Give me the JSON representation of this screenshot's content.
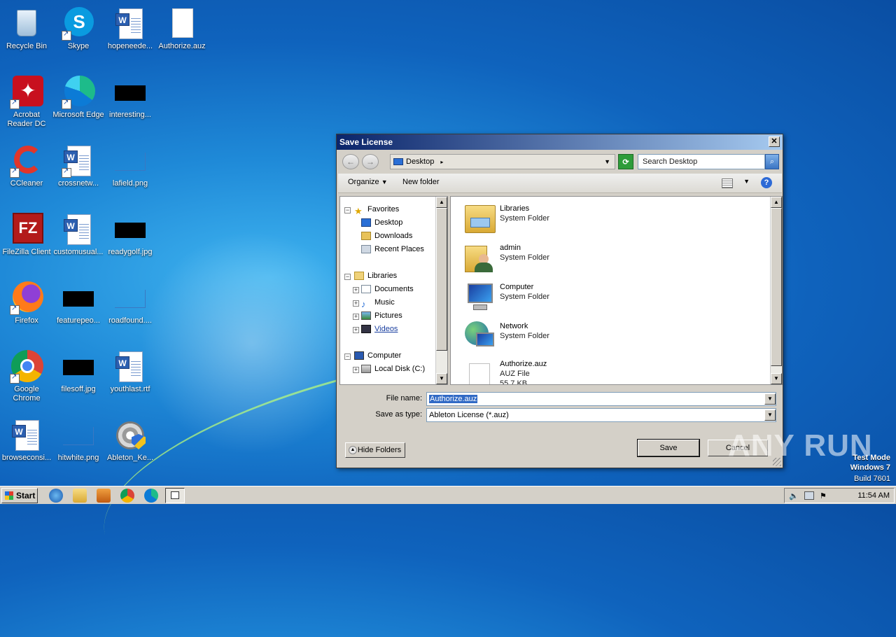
{
  "desktop": {
    "icons": [
      {
        "label": "Recycle Bin"
      },
      {
        "label": "Skype"
      },
      {
        "label": "hopeneede..."
      },
      {
        "label": "Authorize.auz"
      },
      {
        "label": "Acrobat Reader DC"
      },
      {
        "label": "Microsoft Edge"
      },
      {
        "label": "interesting..."
      },
      {
        "label": "CCleaner"
      },
      {
        "label": "crossnetw..."
      },
      {
        "label": "lafield.png"
      },
      {
        "label": "FileZilla Client"
      },
      {
        "label": "customusual..."
      },
      {
        "label": "readygolf.jpg"
      },
      {
        "label": "Firefox"
      },
      {
        "label": "featurepeo..."
      },
      {
        "label": "roadfound...."
      },
      {
        "label": "Google Chrome"
      },
      {
        "label": "filesoff.jpg"
      },
      {
        "label": "youthlast.rtf"
      },
      {
        "label": "browseconsi..."
      },
      {
        "label": "hitwhite.png"
      },
      {
        "label": "Ableton_Ke..."
      }
    ]
  },
  "dialog": {
    "title": "Save License",
    "close_glyph": "✕",
    "address": "Desktop",
    "search_placeholder": "Search Desktop",
    "toolbar": {
      "organize": "Organize",
      "new_folder": "New folder",
      "help": "?"
    },
    "nav": {
      "favorites": "Favorites",
      "desktop": "Desktop",
      "downloads": "Downloads",
      "recent": "Recent Places",
      "libraries": "Libraries",
      "documents": "Documents",
      "music": "Music",
      "pictures": "Pictures",
      "videos": "Videos",
      "computer": "Computer",
      "local_disk": "Local Disk (C:)"
    },
    "files": [
      {
        "name": "Libraries",
        "sub": "System Folder"
      },
      {
        "name": "admin",
        "sub": "System Folder"
      },
      {
        "name": "Computer",
        "sub": "System Folder"
      },
      {
        "name": "Network",
        "sub": "System Folder"
      },
      {
        "name": "Authorize.auz",
        "sub": "AUZ File",
        "sub2": "55.7 KB"
      }
    ],
    "file_name_label": "File name:",
    "file_name_value": "Authorize.auz",
    "save_type_label": "Save as type:",
    "save_type_value": "Ableton License (*.auz)",
    "hide_folders": "Hide Folders",
    "save": "Save",
    "cancel": "Cancel"
  },
  "taskbar": {
    "start": "Start",
    "clock": "11:54 AM"
  },
  "watermark": {
    "line1": "Test Mode",
    "line2": "Windows 7",
    "line3": "Build 7601",
    "brand": "ANY RUN"
  }
}
